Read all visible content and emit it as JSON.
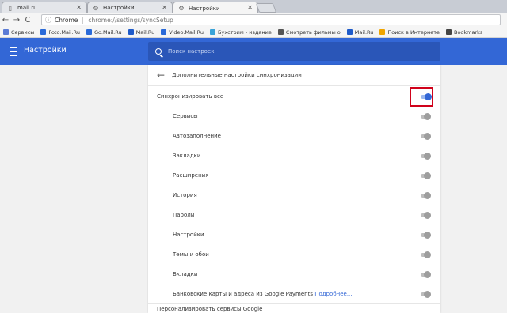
{
  "tabs": [
    {
      "title": "mail.ru",
      "icon": "page-icon"
    },
    {
      "title": "Настройки",
      "icon": "gear-icon"
    },
    {
      "title": "Настройки",
      "icon": "gear-icon",
      "active": true
    }
  ],
  "omnibox": {
    "label": "Chrome",
    "url": "chrome://settings/syncSetup"
  },
  "bookmarks": [
    {
      "label": "Сервисы",
      "color": "#5b7bd5"
    },
    {
      "label": "Foto.Mail.Ru",
      "color": "#2a6ad8"
    },
    {
      "label": "Go.Mail.Ru",
      "color": "#2a6ad8"
    },
    {
      "label": "Mail.Ru",
      "color": "#1f5bc9"
    },
    {
      "label": "Video.Mail.Ru",
      "color": "#2a6ad8"
    },
    {
      "label": "Бухстрим - издание",
      "color": "#3aa3d8"
    },
    {
      "label": "Смотреть фильмы о",
      "color": "#555555"
    },
    {
      "label": "Mail.Ru",
      "color": "#1f5bc9"
    },
    {
      "label": "Поиск в Интернете",
      "color": "#f0a500"
    },
    {
      "label": "Bookmarks",
      "color": "#444444"
    }
  ],
  "header": {
    "title": "Настройки",
    "search_placeholder": "Поиск настроек"
  },
  "sync": {
    "back_title": "Дополнительные настройки синхронизации",
    "sync_all": {
      "label": "Синхронизировать все",
      "enabled": true
    },
    "items": [
      {
        "label": "Сервисы"
      },
      {
        "label": "Автозаполнение"
      },
      {
        "label": "Закладки"
      },
      {
        "label": "Расширения"
      },
      {
        "label": "История"
      },
      {
        "label": "Пароли"
      },
      {
        "label": "Настройки"
      },
      {
        "label": "Темы и обои"
      },
      {
        "label": "Вкладки"
      },
      {
        "label": "Банковские карты и адреса из Google Payments",
        "link": "Подробнее..."
      }
    ],
    "personalize": "Персонализировать сервисы Google"
  },
  "colors": {
    "accent": "#3367d6",
    "highlight": "#d0021b"
  }
}
